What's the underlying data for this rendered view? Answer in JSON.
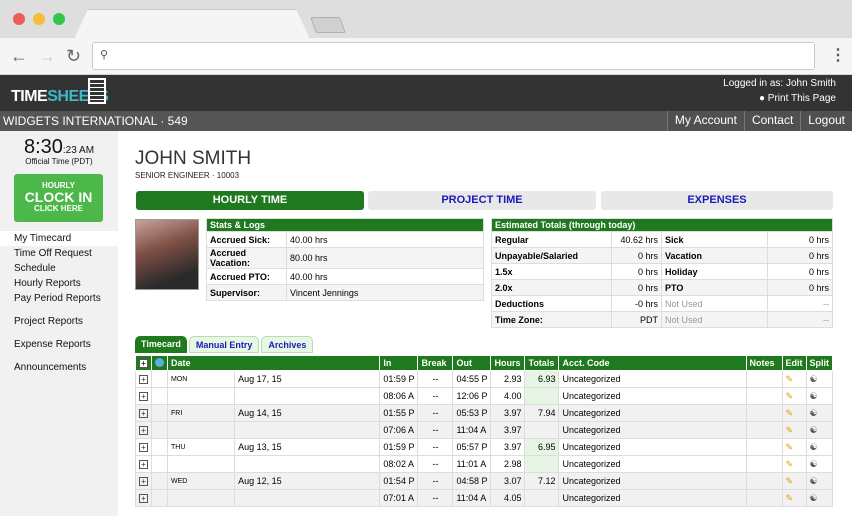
{
  "browser": {
    "back_icon": "←",
    "forward_icon": "→",
    "reload_icon": "↻",
    "search_icon": "🔍",
    "menu_icon": "⋮",
    "url": ""
  },
  "header": {
    "logo_time": "TIME",
    "logo_sheets": "SHEETS",
    "logged_in": "Logged in as: John Smith",
    "print": "● Print This Page",
    "company": "WIDGETS INTERNATIONAL · 549",
    "nav": [
      "My Account",
      "Contact",
      "Logout"
    ]
  },
  "sidebar": {
    "time_main": "8:30",
    "time_sec": ":23 AM",
    "time_label": "Official Time (PDT)",
    "clockin_l1": "HOURLY",
    "clockin_l2": "CLOCK IN",
    "clockin_l3": "CLICK HERE",
    "menu": [
      "My Timecard",
      "Time Off Request",
      "Schedule",
      "Hourly Reports",
      "Pay Period Reports",
      "Project Reports",
      "Expense Reports",
      "Announcements"
    ]
  },
  "employee": {
    "name": "JOHN SMITH",
    "title": "SENIOR ENGINEER · 10003"
  },
  "tabs": [
    "HOURLY TIME",
    "PROJECT TIME",
    "EXPENSES"
  ],
  "stats": {
    "header": "Stats & Logs",
    "rows": [
      {
        "label": "Accrued Sick:",
        "value": "40.00 hrs"
      },
      {
        "label": "Accrued Vacation:",
        "value": "80.00 hrs"
      },
      {
        "label": "Accrued PTO:",
        "value": "40.00 hrs"
      },
      {
        "label": "Supervisor:",
        "value": "Vincent Jennings"
      }
    ]
  },
  "estimates": {
    "header": "Estimated Totals (through today)",
    "rows": [
      {
        "l1": "Regular",
        "v1": "40.62 hrs",
        "l2": "Sick",
        "v2": "0 hrs"
      },
      {
        "l1": "Unpayable/Salaried",
        "v1": "0 hrs",
        "l2": "Vacation",
        "v2": "0 hrs"
      },
      {
        "l1": "1.5x",
        "v1": "0 hrs",
        "l2": "Holiday",
        "v2": "0 hrs"
      },
      {
        "l1": "2.0x",
        "v1": "0 hrs",
        "l2": "PTO",
        "v2": "0 hrs"
      },
      {
        "l1": "Deductions",
        "v1": "-0 hrs",
        "l2": "Not Used",
        "v2": "--"
      },
      {
        "l1": "Time Zone:",
        "v1": "PDT",
        "l2": "Not Used",
        "v2": "--"
      }
    ]
  },
  "timecard_tabs": [
    "Timecard",
    "Manual Entry",
    "Archives"
  ],
  "timecard": {
    "columns": [
      "",
      "",
      "Date",
      "",
      "In",
      "Break",
      "Out",
      "Hours",
      "Totals",
      "Acct. Code",
      "Notes",
      "Edit",
      "Split"
    ],
    "rows": [
      {
        "day": "MON",
        "date": "Aug 17, 15",
        "in": "01:59 P",
        "break": "--",
        "out": "04:55 P",
        "hours": "2.93",
        "total": "6.93",
        "acct": "Uncategorized"
      },
      {
        "day": "",
        "date": "",
        "in": "08:06 A",
        "break": "--",
        "out": "12:06 P",
        "hours": "4.00",
        "total": "",
        "acct": "Uncategorized"
      },
      {
        "day": "FRI",
        "date": "Aug 14, 15",
        "in": "01:55 P",
        "break": "--",
        "out": "05:53 P",
        "hours": "3.97",
        "total": "7.94",
        "acct": "Uncategorized"
      },
      {
        "day": "",
        "date": "",
        "in": "07:06 A",
        "break": "--",
        "out": "11:04 A",
        "hours": "3.97",
        "total": "",
        "acct": "Uncategorized"
      },
      {
        "day": "THU",
        "date": "Aug 13, 15",
        "in": "01:59 P",
        "break": "--",
        "out": "05:57 P",
        "hours": "3.97",
        "total": "6.95",
        "acct": "Uncategorized"
      },
      {
        "day": "",
        "date": "",
        "in": "08:02 A",
        "break": "--",
        "out": "11:01 A",
        "hours": "2.98",
        "total": "",
        "acct": "Uncategorized"
      },
      {
        "day": "WED",
        "date": "Aug 12, 15",
        "in": "01:54 P",
        "break": "--",
        "out": "04:58 P",
        "hours": "3.07",
        "total": "7.12",
        "acct": "Uncategorized"
      },
      {
        "day": "",
        "date": "",
        "in": "07:01 A",
        "break": "--",
        "out": "11:04 A",
        "hours": "4.05",
        "total": "",
        "acct": "Uncategorized"
      }
    ]
  },
  "colors": {
    "brand_green": "#1f7a1f",
    "clockin_green": "#4cb849",
    "link_blue": "#1a1ab8"
  }
}
